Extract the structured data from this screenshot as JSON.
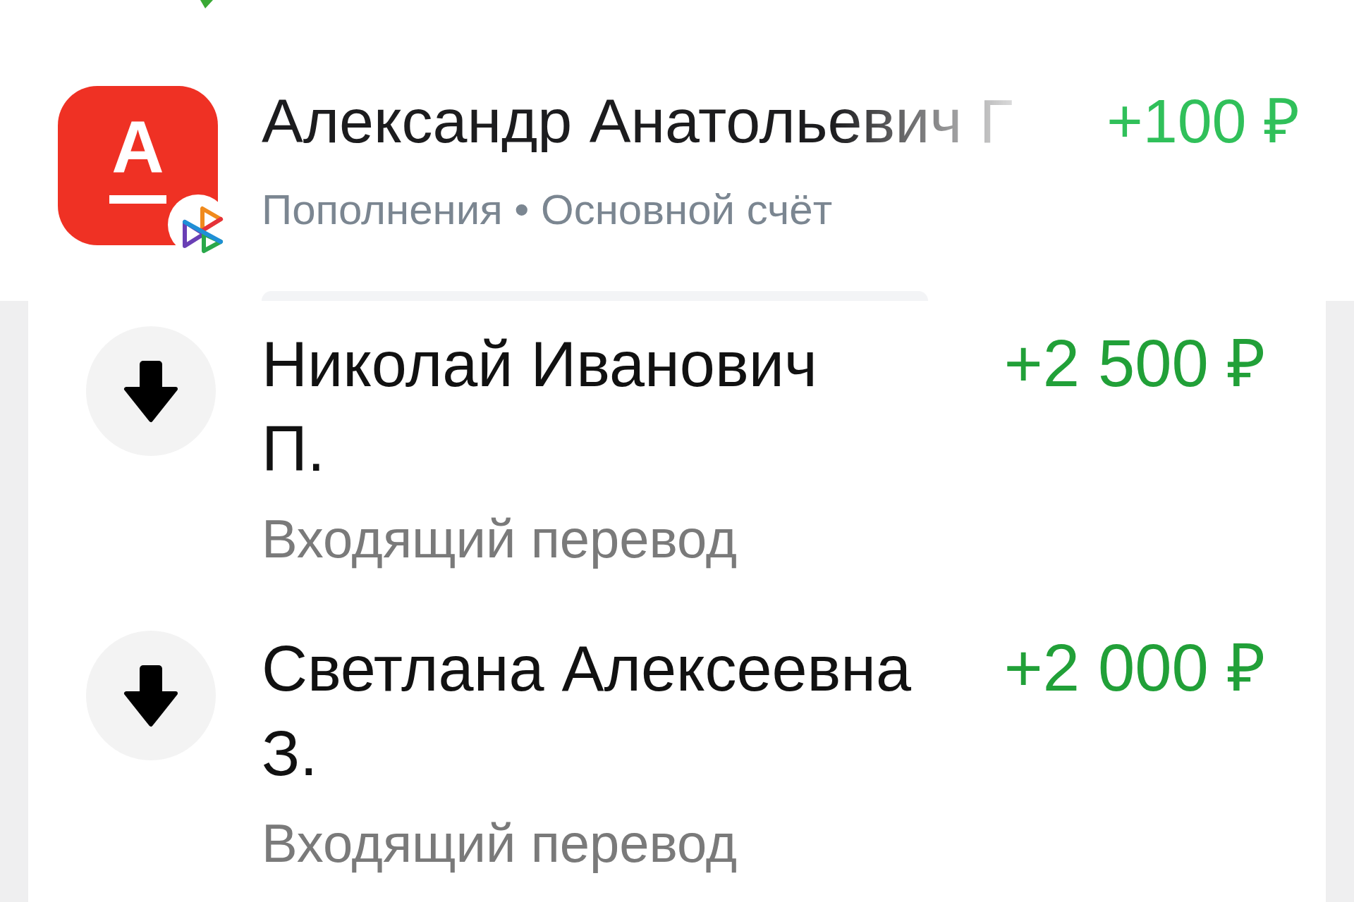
{
  "upper_list": {
    "items": [
      {
        "logo_letter": "А",
        "title": "Александр Анатольевич Г",
        "subtitle": "Пополнения • Основной счёт",
        "amount": "+100 ₽"
      }
    ]
  },
  "transfers": {
    "items": [
      {
        "title": "Николай Иванович П.",
        "subtitle": "Входящий перевод",
        "amount": "+2 500 ₽"
      },
      {
        "title": "Светлана Алексеевна З.",
        "subtitle": "Входящий перевод",
        "amount": "+2 000 ₽"
      }
    ]
  }
}
